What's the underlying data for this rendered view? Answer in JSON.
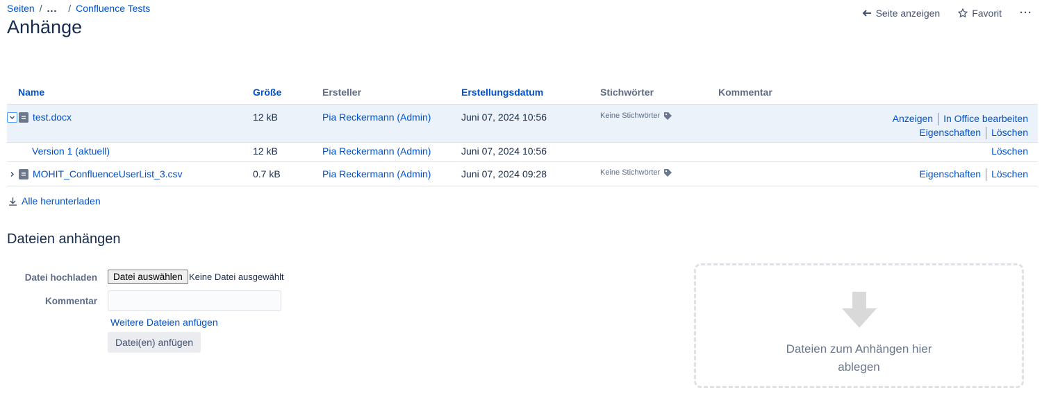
{
  "breadcrumb": {
    "root": "Seiten",
    "ellipsis": "...",
    "current": "Confluence Tests"
  },
  "page_title": "Anhänge",
  "top_actions": {
    "view_page": "Seite anzeigen",
    "favorite": "Favorit",
    "more": "···"
  },
  "table": {
    "headers": {
      "name": "Name",
      "size": "Größe",
      "creator": "Ersteller",
      "created": "Erstellungsdatum",
      "tags": "Stichwörter",
      "comment": "Kommentar"
    },
    "rows": [
      {
        "name": "test.docx",
        "size": "12 kB",
        "creator": "Pia Reckermann (Admin)",
        "created": "Juni 07, 2024 10:56",
        "tags": "Keine Stichwörter",
        "actions": [
          "Anzeigen",
          "In Office bearbeiten",
          "Eigenschaften",
          "Löschen"
        ]
      },
      {
        "name": "Version 1 (aktuell)",
        "size": "12 kB",
        "creator": "Pia Reckermann (Admin)",
        "created": "Juni 07, 2024 10:56",
        "actions": [
          "Löschen"
        ]
      },
      {
        "name": "MOHIT_ConfluenceUserList_3.csv",
        "size": "0.7 kB",
        "creator": "Pia Reckermann (Admin)",
        "created": "Juni 07, 2024 09:28",
        "tags": "Keine Stichwörter",
        "actions": [
          "Eigenschaften",
          "Löschen"
        ]
      }
    ]
  },
  "download_all": "Alle herunterladen",
  "attach": {
    "title": "Dateien anhängen",
    "upload_label": "Datei hochladen",
    "choose_button": "Datei auswählen",
    "no_file": "Keine Datei ausgewählt",
    "comment_label": "Kommentar",
    "comment_value": "",
    "more_files": "Weitere Dateien anfügen",
    "submit": "Datei(en) anfügen",
    "dropzone_text": "Dateien zum Anhängen hier ablegen"
  },
  "colors": {
    "link": "#0052cc",
    "selected_row": "#ebf2f9",
    "text": "#172b4d"
  }
}
